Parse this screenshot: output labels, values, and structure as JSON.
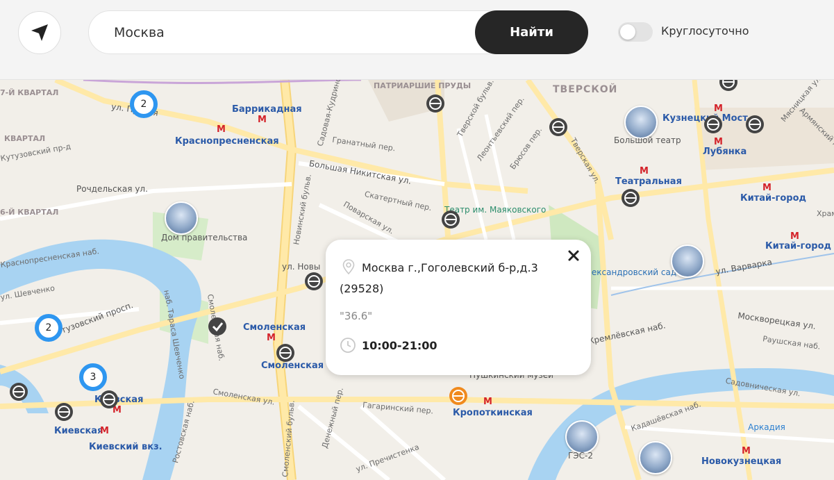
{
  "header": {
    "search": {
      "value": "Москва",
      "button_label": "Найти"
    },
    "toggle": {
      "label": "Круглосуточно",
      "on": false
    }
  },
  "map": {
    "streets": [
      "ул. Пресня",
      "Рочдельская ул.",
      "Гранатный пер.",
      "Большая Никитская ул.",
      "Скатертный пер.",
      "Поварская ул.",
      "ул. Новы",
      "Смоленская наб.",
      "Смоленская ул.",
      "Денежный пер.",
      "Гагаринский пер.",
      "ул. Пречистенка",
      "Кутузовский просп.",
      "наб. Тараса Шевченко",
      "Ростовская наб.",
      "ул. Варварка",
      "Москворецкая ул.",
      "Раушская наб.",
      "Садовническая ул.",
      "Кадашёвская наб.",
      "Тверской бульв.",
      "Леонтьевский пер.",
      "Брюсов пер.",
      "Тверская ул.",
      "Мясницкая ул.",
      "Армянский пер.",
      "Кремлёвская наб.",
      "Садовая-Кудринская ул.",
      "Краснопресненская наб.",
      "Новинский бульв.",
      "Смоленский бульв.",
      "ул. Шевченко",
      "Кутузовский пр-д"
    ],
    "districts": [
      "ТВЕРСКОЙ",
      "ПАТРИАРШИЕ ПРУДЫ",
      "7-Й КВАРТАЛ",
      "6-Й КВАРТАЛ",
      "КВАРТАЛ"
    ],
    "metro": [
      "Баррикадная",
      "Краснопресненская",
      "Смоленская",
      "Смоленская",
      "Киевская",
      "Киевская",
      "Киевский вкз.",
      "Кропоткинская",
      "Театральная",
      "Лубянка",
      "Китай-город",
      "Китай-город",
      "Кузнецкий Мост",
      "Новокузнецкая"
    ],
    "places": [
      "Дом правительства",
      "Большой театр",
      "Театр им. Маяковского",
      "Пушкинский музей",
      "ГЭС-2",
      "Аркадия",
      "Александровский сад",
      "Храм"
    ],
    "clusters": [
      {
        "count": "2"
      },
      {
        "count": "2"
      },
      {
        "count": "3"
      }
    ]
  },
  "popup": {
    "address": "Москва г.,Гоголевский б-р,д.3 (29528)",
    "name": "\"36.6\"",
    "hours": "10:00-21:00"
  },
  "colors": {
    "cluster_ring": "#2e96f0",
    "search_button": "#262626",
    "river": "#a8d3f2",
    "pin_dark": "#444444",
    "pin_active": "#f08a1e"
  }
}
